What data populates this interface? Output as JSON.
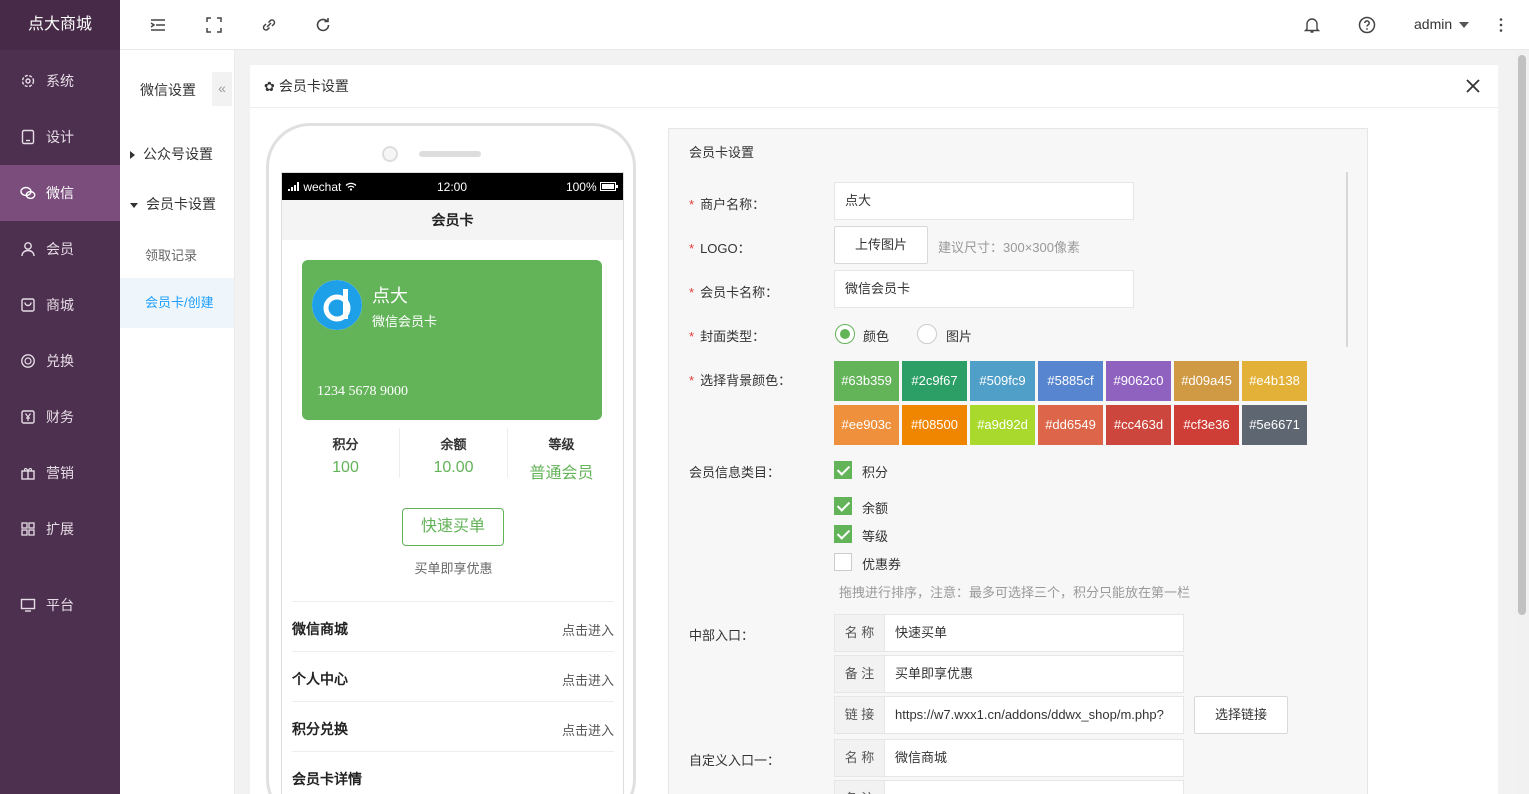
{
  "brand": "点大商城",
  "nav": {
    "system": "系统",
    "design": "设计",
    "wechat": "微信",
    "member": "会员",
    "mall": "商城",
    "exchange": "兑换",
    "finance": "财务",
    "marketing": "营销",
    "extend": "扩展",
    "platform": "平台"
  },
  "topbar": {
    "user": "admin"
  },
  "subnav": {
    "title": "微信设置",
    "collapse": "«",
    "official": "公众号设置",
    "card_settings": "会员卡设置",
    "records": "领取记录",
    "create": "会员卡/创建"
  },
  "panel": {
    "title": "会员卡设置"
  },
  "phone": {
    "carrier": "wechat",
    "time": "12:00",
    "battery": "100%",
    "title": "会员卡",
    "card": {
      "merchant": "点大",
      "card_name": "微信会员卡",
      "number": "1234 5678 9000",
      "color": "#63b359"
    },
    "stats": [
      {
        "label": "积分",
        "value": "100"
      },
      {
        "label": "余额",
        "value": "10.00"
      },
      {
        "label": "等级",
        "value": "普通会员"
      }
    ],
    "quick_btn": "快速买单",
    "quick_note": "买单即享优惠",
    "entries": [
      {
        "name": "微信商城",
        "action": "点击进入"
      },
      {
        "name": "个人中心",
        "action": "点击进入"
      },
      {
        "name": "积分兑换",
        "action": "点击进入"
      },
      {
        "name": "会员卡详情",
        "action": ""
      }
    ]
  },
  "form": {
    "title": "会员卡设置",
    "merchant_label": "商户名称：",
    "merchant_value": "点大",
    "logo_label": "LOGO：",
    "upload_btn": "上传图片",
    "logo_hint": "建议尺寸：300×300像素",
    "card_name_label": "会员卡名称：",
    "card_name_value": "微信会员卡",
    "cover_label": "封面类型：",
    "cover_color": "颜色",
    "cover_image": "图片",
    "bg_label": "选择背景颜色：",
    "swatches": [
      "#63b359",
      "#2c9f67",
      "#509fc9",
      "#5885cf",
      "#9062c0",
      "#d09a45",
      "#e4b138",
      "#ee903c",
      "#f08500",
      "#a9d92d",
      "#dd6549",
      "#cc463d",
      "#cf3e36",
      "#5e6671"
    ],
    "info_label": "会员信息类目：",
    "info_items": [
      {
        "label": "积分",
        "checked": true
      },
      {
        "label": "余额",
        "checked": true
      },
      {
        "label": "等级",
        "checked": true
      },
      {
        "label": "优惠券",
        "checked": false
      }
    ],
    "info_hint": "拖拽进行排序，注意：最多可选择三个，积分只能放在第一栏",
    "middle_label": "中部入口：",
    "middle": {
      "name_pre": "名 称",
      "name_val": "快速买单",
      "note_pre": "备 注",
      "note_val": "买单即享优惠",
      "link_pre": "链 接",
      "link_val": "https://w7.wxx1.cn/addons/ddwx_shop/m.php?",
      "link_btn": "选择链接"
    },
    "custom1_label": "自定义入口一：",
    "custom1": {
      "name_pre": "名 称",
      "name_val": "微信商城",
      "note_pre": "备 注"
    }
  }
}
